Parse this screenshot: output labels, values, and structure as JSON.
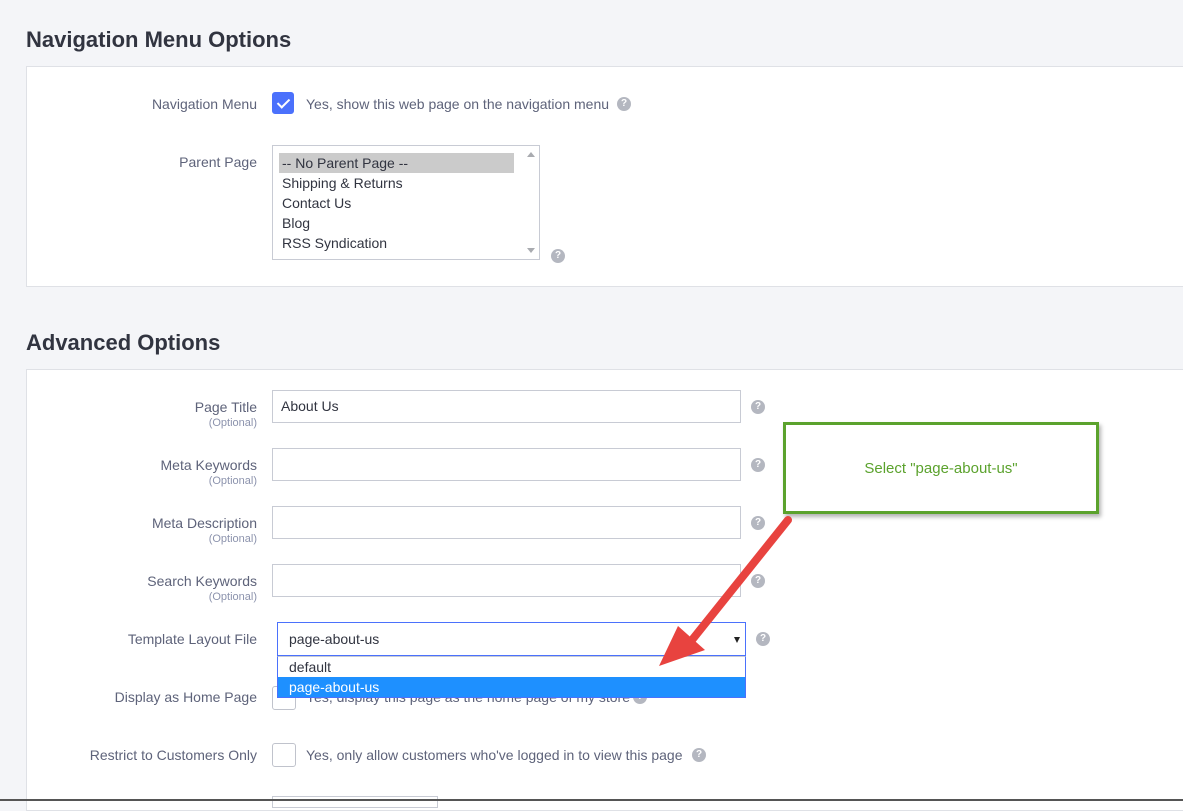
{
  "navigation_section": {
    "title": "Navigation Menu Options",
    "navigation_menu": {
      "label": "Navigation Menu",
      "checked": true,
      "checkbox_text": "Yes, show this web page on the navigation menu"
    },
    "parent_page": {
      "label": "Parent Page",
      "options": [
        "-- No Parent Page --",
        "Shipping & Returns",
        "Contact Us",
        "Blog",
        "RSS Syndication"
      ],
      "selected": "-- No Parent Page --"
    }
  },
  "advanced_section": {
    "title": "Advanced Options",
    "optional_hint": "(Optional)",
    "page_title": {
      "label": "Page Title",
      "value": "About Us"
    },
    "meta_keywords": {
      "label": "Meta Keywords",
      "value": ""
    },
    "meta_description": {
      "label": "Meta Description",
      "value": ""
    },
    "search_keywords": {
      "label": "Search Keywords",
      "value": ""
    },
    "template_layout": {
      "label": "Template Layout File",
      "value": "page-about-us",
      "options": [
        "default",
        "page-about-us"
      ],
      "highlighted": "page-about-us"
    },
    "display_home": {
      "label": "Display as Home Page",
      "checked": false,
      "checkbox_text": "Yes, display this page as the home page of my store"
    },
    "restrict_customers": {
      "label": "Restrict to Customers Only",
      "checked": false,
      "checkbox_text": "Yes, only allow customers who've logged in to view this page"
    }
  },
  "annotation": {
    "callout_text": "Select \"page-about-us\"",
    "border_color": "#5ba22d",
    "arrow_color": "#e8433f"
  },
  "help_icon_glyph": "?",
  "colors": {
    "accent": "#4b71fc",
    "highlight": "#1e90ff"
  }
}
